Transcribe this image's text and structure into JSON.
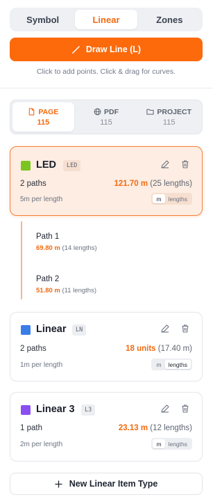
{
  "mode_tabs": [
    {
      "label": "Symbol",
      "active": false
    },
    {
      "label": "Linear",
      "active": true
    },
    {
      "label": "Zones",
      "active": false
    }
  ],
  "draw_button": {
    "label": "Draw Line (L)",
    "icon": "pencil-line-icon"
  },
  "hint": "Click to add points. Click & drag for curves.",
  "scope_tabs": [
    {
      "label": "PAGE",
      "count": "115",
      "icon": "page-icon",
      "active": true
    },
    {
      "label": "PDF",
      "count": "115",
      "icon": "globe-icon",
      "active": false
    },
    {
      "label": "PROJECT",
      "count": "115",
      "icon": "folder-icon",
      "active": false
    }
  ],
  "items": [
    {
      "name": "LED",
      "code": "LED",
      "color": "#7cc520",
      "selected": true,
      "paths": "2 paths",
      "total_value": "121.70 m",
      "total_detail": "(25 lengths)",
      "per_length": "5m per length",
      "unit_options": [
        "m",
        "lengths"
      ],
      "unit_selected": "m",
      "path_list": [
        {
          "name": "Path 1",
          "length": "69.80 m",
          "detail": "(14 lengths)"
        },
        {
          "name": "Path 2",
          "length": "51.80 m",
          "detail": "(11 lengths)"
        }
      ]
    },
    {
      "name": "Linear",
      "code": "LN",
      "color": "#3b7de8",
      "selected": false,
      "paths": "2 paths",
      "total_value": "18 units",
      "total_detail": "(17.40 m)",
      "per_length": "1m per length",
      "unit_options": [
        "m",
        "lengths"
      ],
      "unit_selected": "lengths"
    },
    {
      "name": "Linear 3",
      "code": "L3",
      "color": "#8a4ff0",
      "selected": false,
      "paths": "1 path",
      "total_value": "23.13 m",
      "total_detail": "(12 lengths)",
      "per_length": "2m per length",
      "unit_options": [
        "m",
        "lengths"
      ],
      "unit_selected": "m"
    }
  ],
  "new_item_button": {
    "label": "New Linear Item Type",
    "icon": "plus-icon"
  },
  "colors": {
    "accent": "#fc6a0c",
    "accent_text": "#f26a10",
    "selected_bg": "#fdede3"
  }
}
